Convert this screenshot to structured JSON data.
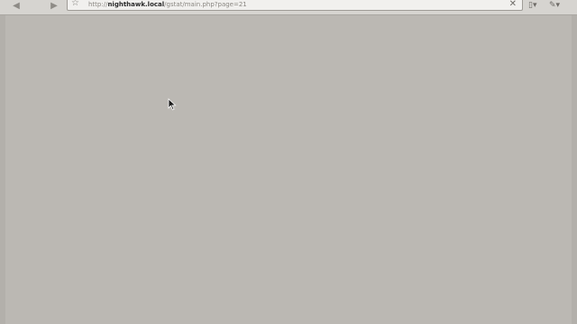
{
  "toolbar": {
    "url": {
      "scheme": "http://",
      "host": "nighthawk.local",
      "path": "/gstat/main.php?page=21"
    },
    "icons": {
      "back": "back-arrow-icon",
      "forward": "forward-arrow-icon",
      "bookmark": "star-icon",
      "stop": "close-icon",
      "page_menu": "page-menu-icon",
      "tools_menu": "wrench-icon"
    }
  },
  "content": {
    "state": "blank"
  },
  "colors": {
    "page_background": "#bbb8b3",
    "toolbar_background": "#d6d4d0",
    "url_bar_background": "#f1f0ee"
  }
}
